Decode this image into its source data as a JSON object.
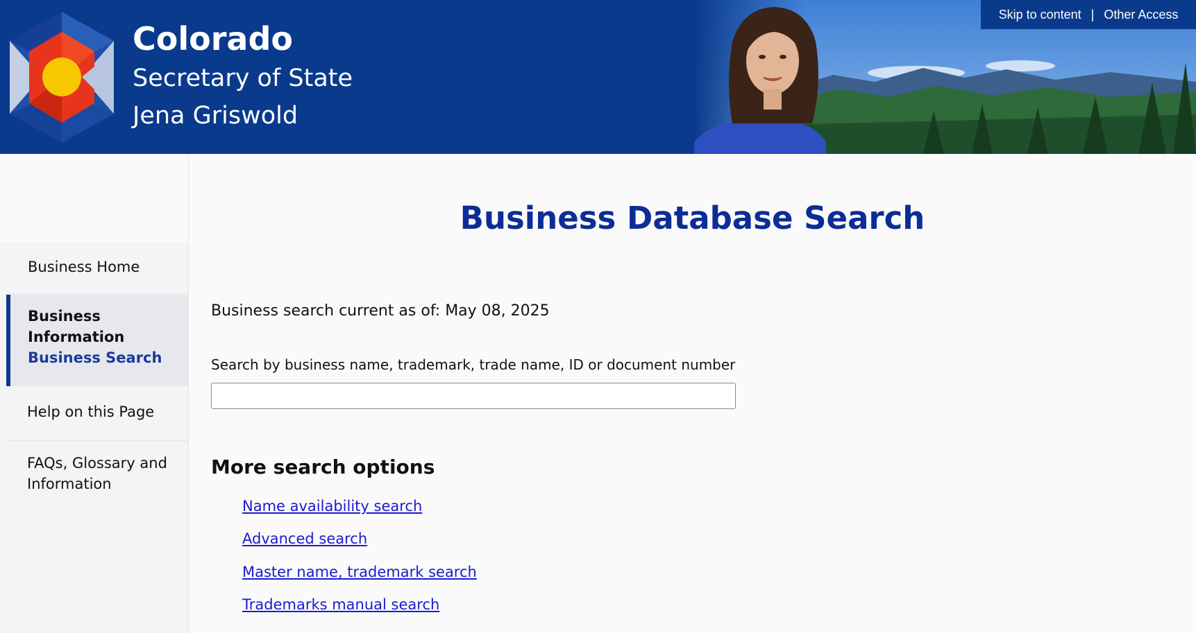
{
  "header": {
    "state": "Colorado",
    "office": "Secretary of State",
    "official": "Jena Griswold",
    "skip_link": "Skip to content",
    "separator": "|",
    "other_access": "Other Access",
    "colors": {
      "banner": "#0a3a8c",
      "flag_red": "#e8341c",
      "flag_gold": "#f7c800"
    }
  },
  "sidebar": {
    "home": "Business Home",
    "info_label": "Business Information",
    "active_label": "Business Search",
    "help": "Help on this Page",
    "faq": "FAQs, Glossary and Information"
  },
  "main": {
    "title": "Business Database Search",
    "current_as_of": "Business search current as of: May 08, 2025",
    "search_label": "Search by business name, trademark, trade name, ID or document number",
    "search_value": "",
    "more_heading": "More search options",
    "links": [
      "Name availability search",
      "Advanced search",
      "Master name, trademark search",
      "Trademarks manual search"
    ]
  }
}
